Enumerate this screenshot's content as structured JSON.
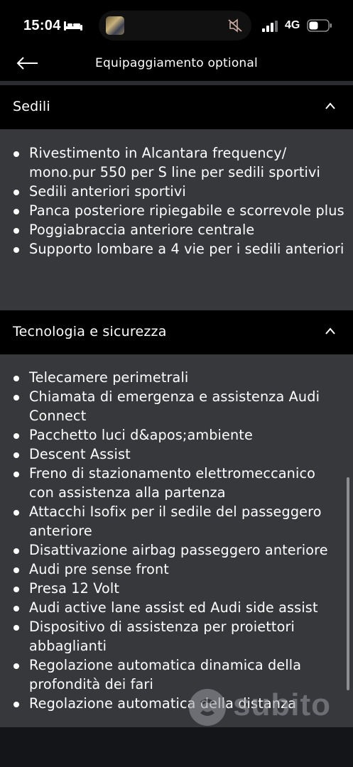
{
  "status_bar": {
    "time": "15:04",
    "network": "4G",
    "icons": [
      "bed-icon",
      "signal-icon",
      "battery-icon",
      "mute-icon"
    ]
  },
  "nav": {
    "title": "Equipaggiamento optional",
    "back_icon": "arrow-left-icon"
  },
  "sections": [
    {
      "title": "Sedili",
      "expanded": true,
      "items": [
        "Rivestimento in Alcantara frequency/ mono.pur 550 per S line per sedili sportivi",
        "Sedili anteriori sportivi",
        "Panca posteriore ripiegabile e scorrevole plus",
        "Poggiabraccia anteriore centrale",
        "Supporto lombare a 4 vie per i sedili anteriori"
      ]
    },
    {
      "title": "Tecnologia e sicurezza",
      "expanded": true,
      "items": [
        "Telecamere perimetrali",
        "Chiamata di emergenza e assistenza Audi Connect",
        "Pacchetto luci d&apos;ambiente",
        "Descent Assist",
        "Freno di stazionamento elettromeccanico con assistenza alla partenza",
        "Attacchi Isofix per il sedile del passeggero anteriore",
        "Disattivazione airbag passeggero anteriore",
        "Audi pre sense front",
        "Presa 12 Volt",
        "Audi active lane assist ed Audi side assist",
        "Dispositivo di assistenza per proiettori abbaglianti",
        "Regolazione automatica dinamica della profondità dei fari",
        "Regolazione automatica della distanza"
      ]
    }
  ],
  "watermark": {
    "text": "subito"
  },
  "colors": {
    "background": "#000000",
    "section_body": "#37383c",
    "text": "#ffffff",
    "divider": "#2a2b2e"
  }
}
